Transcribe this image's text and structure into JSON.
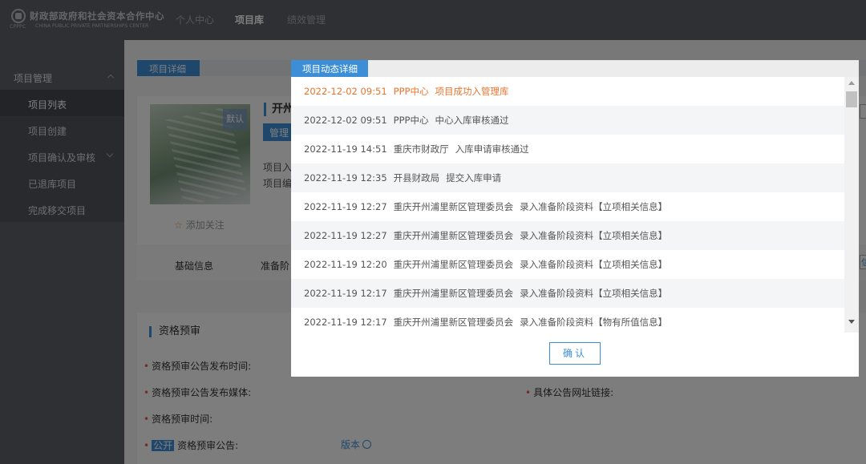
{
  "header": {
    "logo_cn": "财政部政府和社会资本合作中心",
    "logo_en": "CHINA PUBLIC PRIVATE PARTNERSHIPS CENTER",
    "logo_small": "CPPPC",
    "nav": [
      "个人中心",
      "项目库",
      "绩效管理"
    ],
    "active_nav": "项目库"
  },
  "sidebar": {
    "group_label": "项目管理",
    "items": [
      {
        "label": "项目列表",
        "active": true
      },
      {
        "label": "项目创建",
        "active": false
      },
      {
        "label": "项目确认及审核",
        "active": false,
        "has_submenu": true
      },
      {
        "label": "已退库项目",
        "active": false
      },
      {
        "label": "完成移交项目",
        "active": false
      }
    ]
  },
  "main": {
    "tab_title": "项目详细",
    "project_title_fragment": "开州",
    "image_badge": "默认",
    "manage_button_fragment": "管理",
    "info_lines": [
      "项目入",
      "项目编"
    ],
    "follow_label": "添加关注",
    "subtabs": [
      "基础信息",
      "准备阶"
    ],
    "section_title": "资格预审",
    "fields": [
      "资格预审公告发布时间:",
      "资格预审公告发布媒体:",
      "资格预审时间:",
      "资格预审公告:"
    ],
    "field_right": "具体公告网址链接:",
    "public_tag": "公开",
    "version_link": "版本",
    "right_edge_fragment": "信"
  },
  "modal": {
    "title": "项目动态详细",
    "logs": [
      {
        "time": "2022-12-02 09:51",
        "actor": "PPP中心",
        "action": "项目成功入管理库",
        "highlight": true
      },
      {
        "time": "2022-12-02 09:51",
        "actor": "PPP中心",
        "action": "中心入库审核通过"
      },
      {
        "time": "2022-11-19 14:51",
        "actor": "重庆市财政厅",
        "action": "入库申请审核通过"
      },
      {
        "time": "2022-11-19 12:35",
        "actor": "开县财政局",
        "action": "提交入库申请"
      },
      {
        "time": "2022-11-19 12:27",
        "actor": "重庆开州浦里新区管理委员会",
        "action": "录入准备阶段资料【立项相关信息】"
      },
      {
        "time": "2022-11-19 12:27",
        "actor": "重庆开州浦里新区管理委员会",
        "action": "录入准备阶段资料【立项相关信息】"
      },
      {
        "time": "2022-11-19 12:20",
        "actor": "重庆开州浦里新区管理委员会",
        "action": "录入准备阶段资料【立项相关信息】"
      },
      {
        "time": "2022-11-19 12:17",
        "actor": "重庆开州浦里新区管理委员会",
        "action": "录入准备阶段资料【立项相关信息】"
      },
      {
        "time": "2022-11-19 12:17",
        "actor": "重庆开州浦里新区管理委员会",
        "action": "录入准备阶段资料【物有所值信息】"
      }
    ],
    "confirm_label": "确认"
  },
  "colors": {
    "accent": "#3c8fd6",
    "highlight": "#e8742c",
    "topbar": "#5c6068"
  }
}
